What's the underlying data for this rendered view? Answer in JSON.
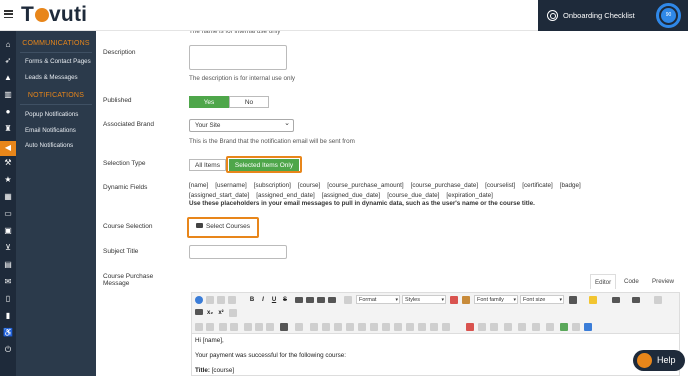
{
  "app": {
    "logo_text": "Tovuti",
    "onboarding_label": "Onboarding Checklist",
    "onboarding_progress": "90"
  },
  "menu": {
    "sections": [
      {
        "title": "COMMUNICATIONS",
        "items": [
          "Forms & Contact Pages",
          "Leads & Messages"
        ]
      },
      {
        "title": "NOTIFICATIONS",
        "items": [
          "Popup Notifications",
          "Email Notifications",
          "Auto Notifications"
        ]
      }
    ]
  },
  "form": {
    "name_help": "The name is for internal use only",
    "description_label": "Description",
    "description_help": "The description is for internal use only",
    "published_label": "Published",
    "published_yes": "Yes",
    "published_no": "No",
    "brand_label": "Associated Brand",
    "brand_value": "Your Site",
    "brand_help": "This is the Brand that the notification email will be sent from",
    "selection_label": "Selection Type",
    "selection_all": "All Items",
    "selection_selected": "Selected Items Only",
    "dynamic_label": "Dynamic Fields",
    "dynamic_fields": [
      "[name]",
      "[username]",
      "[subscription]",
      "[course]",
      "[course_purchase_amount]",
      "[course_purchase_date]",
      "[courselist]",
      "[certificate]",
      "[badge]",
      "[assigned_start_date]",
      "[assigned_end_date]",
      "[assigned_due_date]",
      "[course_due_date]",
      "[expiration_date]"
    ],
    "dynamic_help": "Use these placeholders in your email messages to pull in dynamic data, such as the user's name or the course title.",
    "course_selection_label": "Course Selection",
    "select_courses_button": "Select Courses",
    "subject_label": "Subject Title",
    "message_label_line1": "Course Purchase",
    "message_label_line2": "Message"
  },
  "editor": {
    "tabs": [
      "Editor",
      "Code",
      "Preview"
    ],
    "format_select": "Format",
    "styles_select": "Styles",
    "font_family_select": "Font family",
    "font_size_select": "Font size",
    "body_lines": [
      "Hi [name],",
      "Your payment was successful for the following course:"
    ],
    "title_label": "Title:",
    "title_value": "[course]"
  },
  "help_button": "Help"
}
